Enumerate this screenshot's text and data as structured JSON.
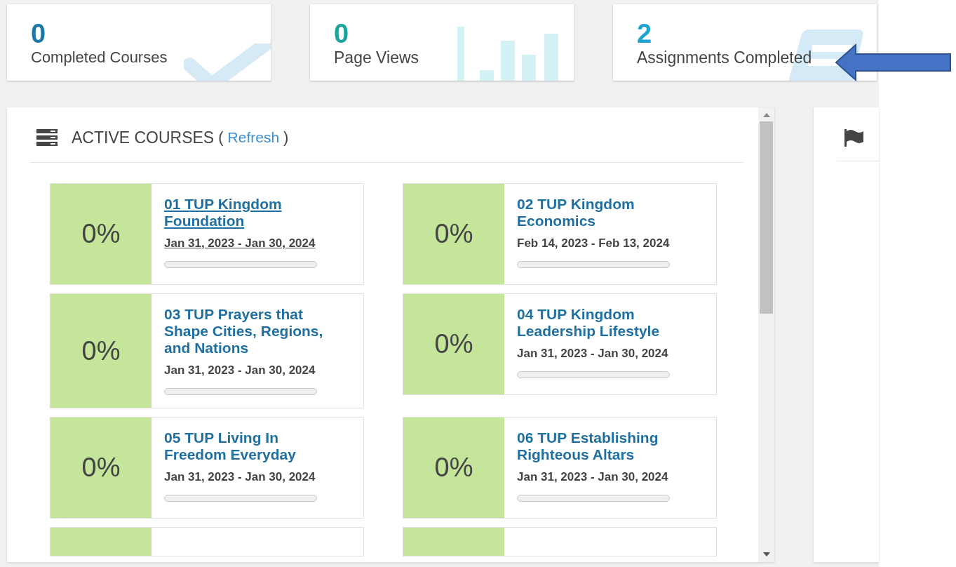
{
  "stats": [
    {
      "kind": "check",
      "value": "0",
      "label": "Completed Courses"
    },
    {
      "kind": "bars",
      "value": "0",
      "label": "Page Views"
    },
    {
      "kind": "doc",
      "value": "2",
      "label": "Assignments Completed"
    }
  ],
  "active_courses": {
    "title": "ACTIVE COURSES",
    "open_paren": "(",
    "refresh": "Refresh",
    "close_paren": ")",
    "courses": [
      {
        "kind": "course",
        "percent": "0%",
        "title": "01 TUP Kingdom Foundation",
        "dates": "Jan 31, 2023 - Jan 30, 2024",
        "level": 0,
        "hovered": true
      },
      {
        "kind": "course",
        "percent": "0%",
        "title": "02 TUP Kingdom Economics",
        "dates": "Feb 14, 2023 - Feb 13, 2024",
        "level": 0,
        "hovered": false
      },
      {
        "kind": "course",
        "percent": "0%",
        "title": "03 TUP Prayers that Shape Cities, Regions, and Nations",
        "dates": "Jan 31, 2023 - Jan 30, 2024",
        "level": 0,
        "hovered": false
      },
      {
        "kind": "course",
        "percent": "0%",
        "title": "04 TUP Kingdom Leadership Lifestyle",
        "dates": "Jan 31, 2023 - Jan 30, 2024",
        "level": 0,
        "hovered": false
      },
      {
        "kind": "course",
        "percent": "0%",
        "title": "05 TUP Living In Freedom Everyday",
        "dates": "Jan 31, 2023 - Jan 30, 2024",
        "level": 0,
        "hovered": false
      },
      {
        "kind": "course",
        "percent": "0%",
        "title": "06 TUP Establishing Righteous Altars",
        "dates": "Jan 31, 2023 - Jan 30, 2024",
        "level": 0,
        "hovered": false
      },
      {
        "kind": "stub"
      },
      {
        "kind": "stub"
      }
    ]
  }
}
